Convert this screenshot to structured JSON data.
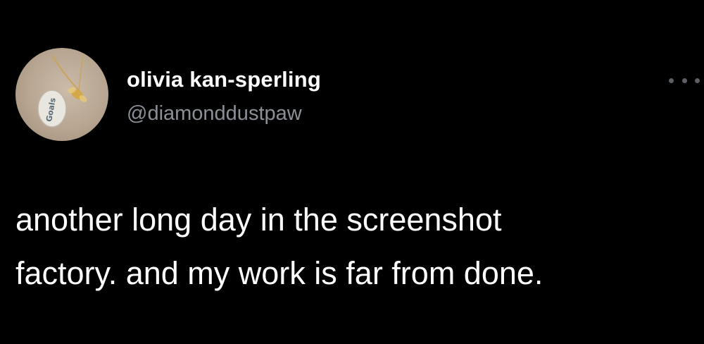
{
  "tweet": {
    "author": {
      "display_name": "olivia kan-sperling",
      "handle": "@diamonddustpaw",
      "avatar_icon": "pendant-necklace-photo",
      "avatar_pendant_text": "Goals"
    },
    "more_icon": "ellipsis-icon",
    "text_lines": [
      "another long day in the screenshot",
      "factory. and my work is far from done."
    ]
  },
  "colors": {
    "background": "#000000",
    "name": "#ffffff",
    "handle": "#8b9096",
    "body_text": "#ffffff",
    "more_dots": "#5d6166"
  }
}
